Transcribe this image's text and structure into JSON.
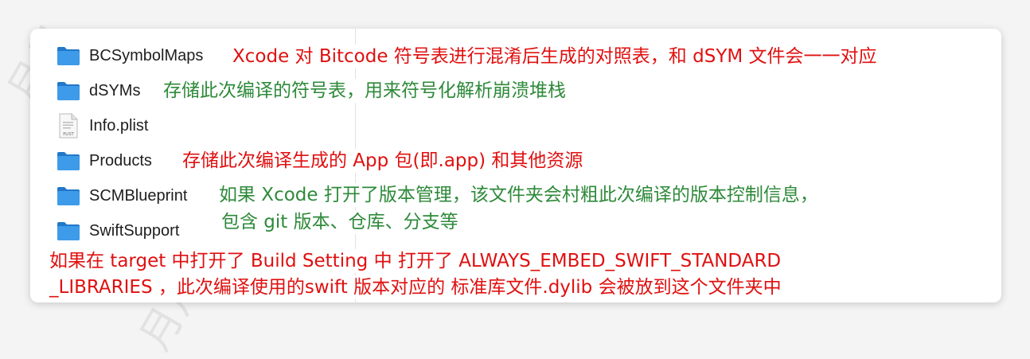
{
  "files": [
    {
      "name": "BCSymbolMaps",
      "icon": "folder-icon"
    },
    {
      "name": "dSYMs",
      "icon": "folder-icon"
    },
    {
      "name": "Info.plist",
      "icon": "plist-file-icon",
      "icon_label": "PLIST"
    },
    {
      "name": "Products",
      "icon": "folder-icon"
    },
    {
      "name": "SCMBlueprint",
      "icon": "folder-icon"
    },
    {
      "name": "SwiftSupport",
      "icon": "folder-icon"
    }
  ],
  "annotations": {
    "bcsymbolmaps": "Xcode 对 Bitcode 符号表进行混淆后生成的对照表，和 dSYM 文件会一一对应",
    "dsyms": "存储此次编译的符号表，用来符号化解析崩溃堆栈",
    "products": "存储此次编译生成的 App 包(即.app) 和其他资源",
    "scmblueprint_line1": "如果 Xcode 打开了版本管理，该文件夹会村粗此次编译的版本控制信息，",
    "scmblueprint_line2": "包含 git 版本、仓库、分支等",
    "swiftsupport_line1": "如果在 target 中打开了 Build  Setting  中  打开了 ALWAYS_EMBED_SWIFT_STANDARD",
    "swiftsupport_line2": "_LIBRARIES ，此次编译使用的swift 版本对应的 标准库文件.dylib 会被放到这个文件夹中"
  },
  "watermarks": [
    "月月",
    "Style 月月",
    "月月"
  ],
  "colors": {
    "annotation_red": "#e01010",
    "annotation_green": "#2e8a3a",
    "folder_blue": "#2f8fe0"
  }
}
